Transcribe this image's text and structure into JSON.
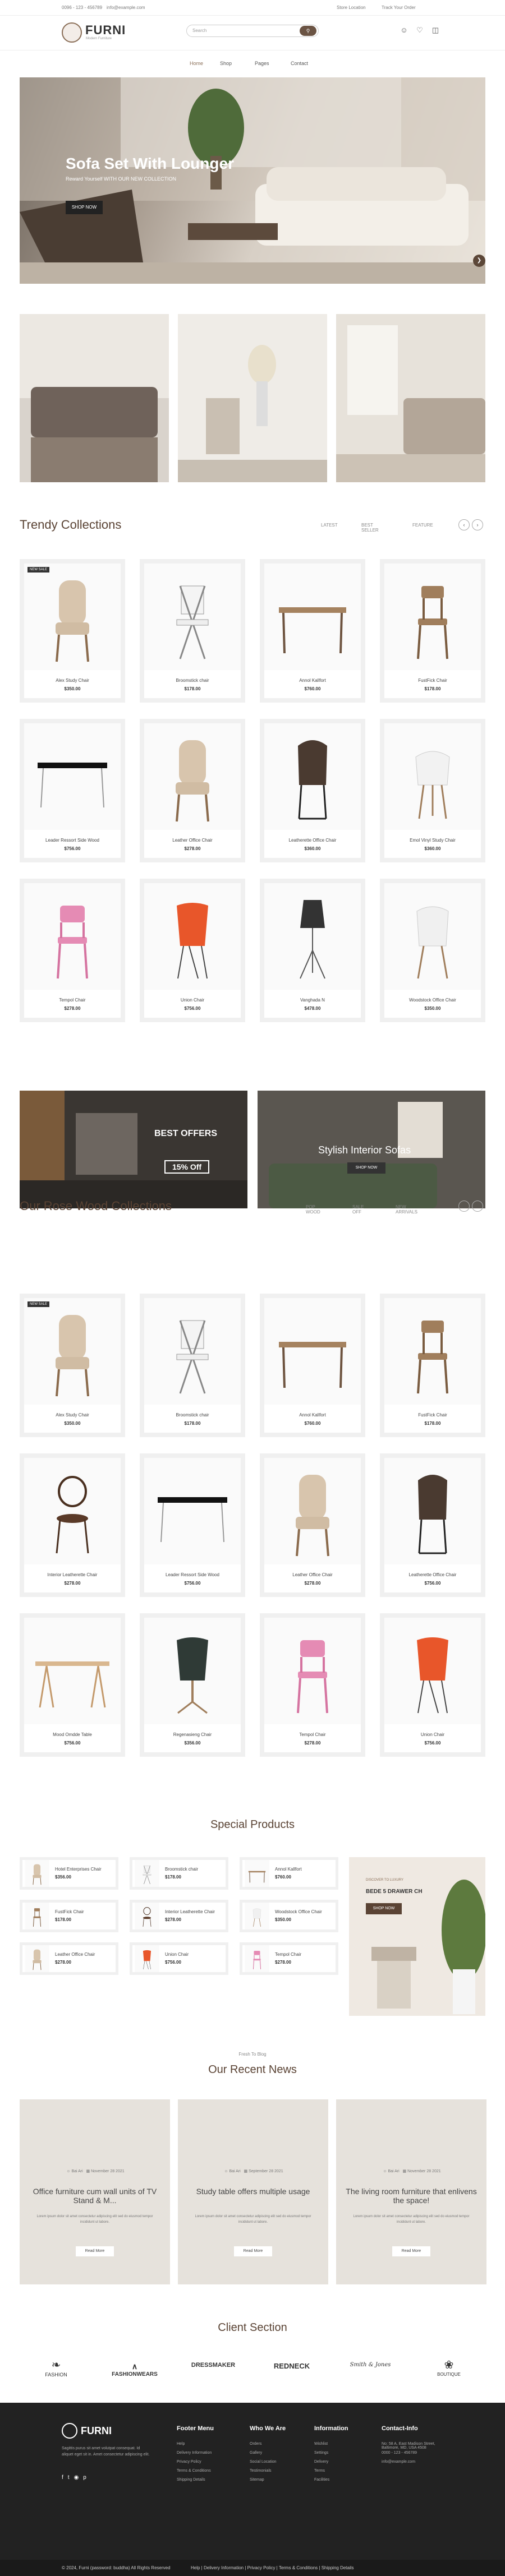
{
  "topbar": {
    "phone": "0096 - 123 - 456789",
    "email": "info@example.com",
    "location": "Store Location",
    "track": "Track Your Order"
  },
  "header": {
    "logo": "FURNI",
    "logo_sub": "Modern Furniture",
    "search_placeholder": "Search"
  },
  "nav": {
    "items": [
      "Home",
      "Shop",
      "Pages",
      "Contact"
    ]
  },
  "hero": {
    "title": "Sofa Set With Lounger",
    "subtitle": "Reward Yourself WITH OUR NEW COLLECTION",
    "button": "SHOP NOW"
  },
  "trendy": {
    "title": "Trendy Collections",
    "tabs": [
      "LATEST",
      "BEST SELLER",
      "FEATURE"
    ],
    "products": [
      {
        "name": "Alex Study Chair",
        "price": "$350.00",
        "sale": "NEW SALE"
      },
      {
        "name": "Broomstick chair",
        "price": "$178.00"
      },
      {
        "name": "Annol Kallfort",
        "price": "$760.00"
      },
      {
        "name": "FustFick Chair",
        "price": "$178.00"
      },
      {
        "name": "Leader Ressort Side Wood",
        "price": "$756.00"
      },
      {
        "name": "Leather Office Chair",
        "price": "$278.00"
      },
      {
        "name": "Leatherette Office Chair",
        "price": "$360.00"
      },
      {
        "name": "Emol Vinyl Study Chair",
        "price": "$360.00"
      },
      {
        "name": "Tempol Chair",
        "price": "$278.00"
      },
      {
        "name": "Union Chair",
        "price": "$756.00"
      },
      {
        "name": "Vanghada N",
        "price": "$478.00"
      },
      {
        "name": "Woodstock Office Chair",
        "price": "$350.00"
      }
    ]
  },
  "offers": {
    "best": "BEST OFFERS",
    "best_discount": "15% Off",
    "sofas": "Stylish Interior Sofas",
    "sofas_btn": "SHOP NOW"
  },
  "rosewood": {
    "title": "Our Rose Wood Collections",
    "tabs": [
      "POP WOOD",
      "SALE OFF",
      "NEW ARRIVALS"
    ],
    "products": [
      {
        "name": "Alex Study Chair",
        "price": "$350.00",
        "sale": "NEW SALE"
      },
      {
        "name": "Broomstick chair",
        "price": "$178.00"
      },
      {
        "name": "Annol Kallfort",
        "price": "$760.00"
      },
      {
        "name": "FustFick Chair",
        "price": "$178.00"
      },
      {
        "name": "Interior Leatherette Chair",
        "price": "$278.00"
      },
      {
        "name": "Leader Ressort Side Wood",
        "price": "$756.00"
      },
      {
        "name": "Leather Office Chair",
        "price": "$278.00"
      },
      {
        "name": "Leatherette Office Chair",
        "price": "$756.00"
      },
      {
        "name": "Mood Omdde Table",
        "price": "$756.00"
      },
      {
        "name": "Regenasieng Chair",
        "price": "$356.00"
      },
      {
        "name": "Tempol Chair",
        "price": "$278.00"
      },
      {
        "name": "Union Chair",
        "price": "$756.00"
      }
    ]
  },
  "special": {
    "title": "Special Products",
    "items": [
      {
        "name": "Hotel Enterprises Chair",
        "price": "$356.00"
      },
      {
        "name": "Broomstick chair",
        "price": "$178.00"
      },
      {
        "name": "Annol Kallfort",
        "price": "$760.00"
      },
      {
        "name": "FustFick Chair",
        "price": "$178.00"
      },
      {
        "name": "Interior Leatherette Chair",
        "price": "$278.00"
      },
      {
        "name": "Woodstock Office Chair",
        "price": "$350.00"
      },
      {
        "name": "Leather Office Chair",
        "price": "$278.00"
      },
      {
        "name": "Union Chair",
        "price": "$756.00"
      },
      {
        "name": "Tempol Chair",
        "price": "$278.00"
      }
    ],
    "promo_tag": "DISCOVER TO LUXURY",
    "promo_title": "BEDE 5 DRAWER CH",
    "promo_btn": "SHOP NOW"
  },
  "news": {
    "kicker": "Fresh To Blog",
    "title": "Our Recent News",
    "items": [
      {
        "author": "Bai Ari",
        "date": "November 28 2021",
        "title": "Office furniture cum wall units of TV Stand & M...",
        "text": "Lorem ipsum dolor sit amet consectetur adipiscing elit sed do eiusmod tempor incididunt ut labore.",
        "btn": "Read More"
      },
      {
        "author": "Bai Ari",
        "date": "September 28 2021",
        "title": "Study table offers multiple usage",
        "text": "Lorem ipsum dolor sit amet consectetur adipiscing elit sed do eiusmod tempor incididunt ut labore.",
        "btn": "Read More"
      },
      {
        "author": "Bai Ari",
        "date": "November 28 2021",
        "title": "The living room furniture that enlivens the space!",
        "text": "Lorem ipsum dolor sit amet consectetur adipiscing elit sed do eiusmod tempor incididunt ut labore.",
        "btn": "Read More"
      }
    ]
  },
  "clients": {
    "title": "Client Section",
    "brands": [
      "FASHION",
      "FASHIONWEARS",
      "DRESSMAKER",
      "REDNECK",
      "Smith & Jones",
      "BOUTIQUE"
    ]
  },
  "footer": {
    "logo": "FURNI",
    "about": "Sagittis purus sit amet volutpat consequat. Id aliquet eget sit in. Amet consectetur adipiscing elit.",
    "cols": [
      {
        "title": "Footer Menu",
        "items": [
          "Help",
          "Delivery Information",
          "Privacy Policy",
          "Terms & Conditions",
          "Shipping Details"
        ]
      },
      {
        "title": "Who We Are",
        "items": [
          "Orders",
          "Gallery",
          "Social Location",
          "Testimonials",
          "Sitemap"
        ]
      },
      {
        "title": "Information",
        "items": [
          "Wishlist",
          "Settings",
          "Delivery",
          "Terms",
          "Facilities"
        ]
      },
      {
        "title": "Contact-Info",
        "items": [
          "No: 58 A, East Madison Street, Baltimore, MD, USA 4508",
          "0000 - 123 - 456789",
          "info@example.com"
        ]
      }
    ],
    "copyright": "© 2024, Furni (password: buddha) All Rights Reserved",
    "bottom_links": [
      "Help",
      "Delivery Information",
      "Privacy Policy",
      "Terms & Conditions",
      "Shipping Details"
    ]
  }
}
